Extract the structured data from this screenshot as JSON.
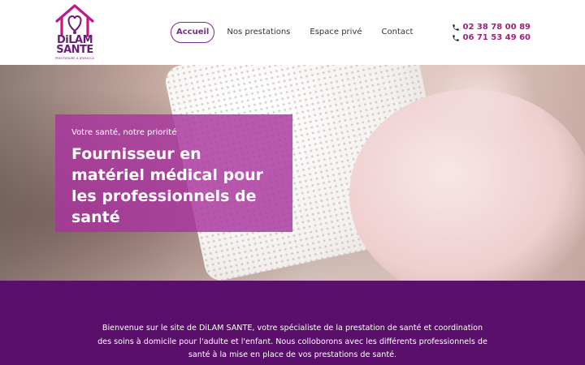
{
  "logo": {
    "name_line1": "DiLAM",
    "name_line2": "SANTE",
    "tagline": "PRESTATAIRE À DOMICILE"
  },
  "nav": {
    "items": [
      {
        "label": "Accueil",
        "active": true
      },
      {
        "label": "Nos prestations",
        "active": false
      },
      {
        "label": "Espace privé",
        "active": false
      },
      {
        "label": "Contact",
        "active": false
      }
    ]
  },
  "contact": {
    "phone1": "02 38 78 00 89",
    "phone2": "06 71 53 49 60"
  },
  "hero": {
    "kicker": "Votre santé, notre priorité",
    "title": "Fournisseur en matériel médical pour les professionnels de santé"
  },
  "intro": {
    "text": "Bienvenue sur le site de DiLAM SANTE, votre spécialiste de la prestation de santé et coordination des soins à domicile pour l'adulte et l'enfant. Nous colloborons avec les différents professionnels de santé à la mise en place de vos prestations de santé."
  },
  "colors": {
    "brand_purple": "#6d1b7b",
    "accent_magenta": "#a0207f",
    "hero_overlay": "#a8349e",
    "intro_band": "#5a0f6b"
  }
}
